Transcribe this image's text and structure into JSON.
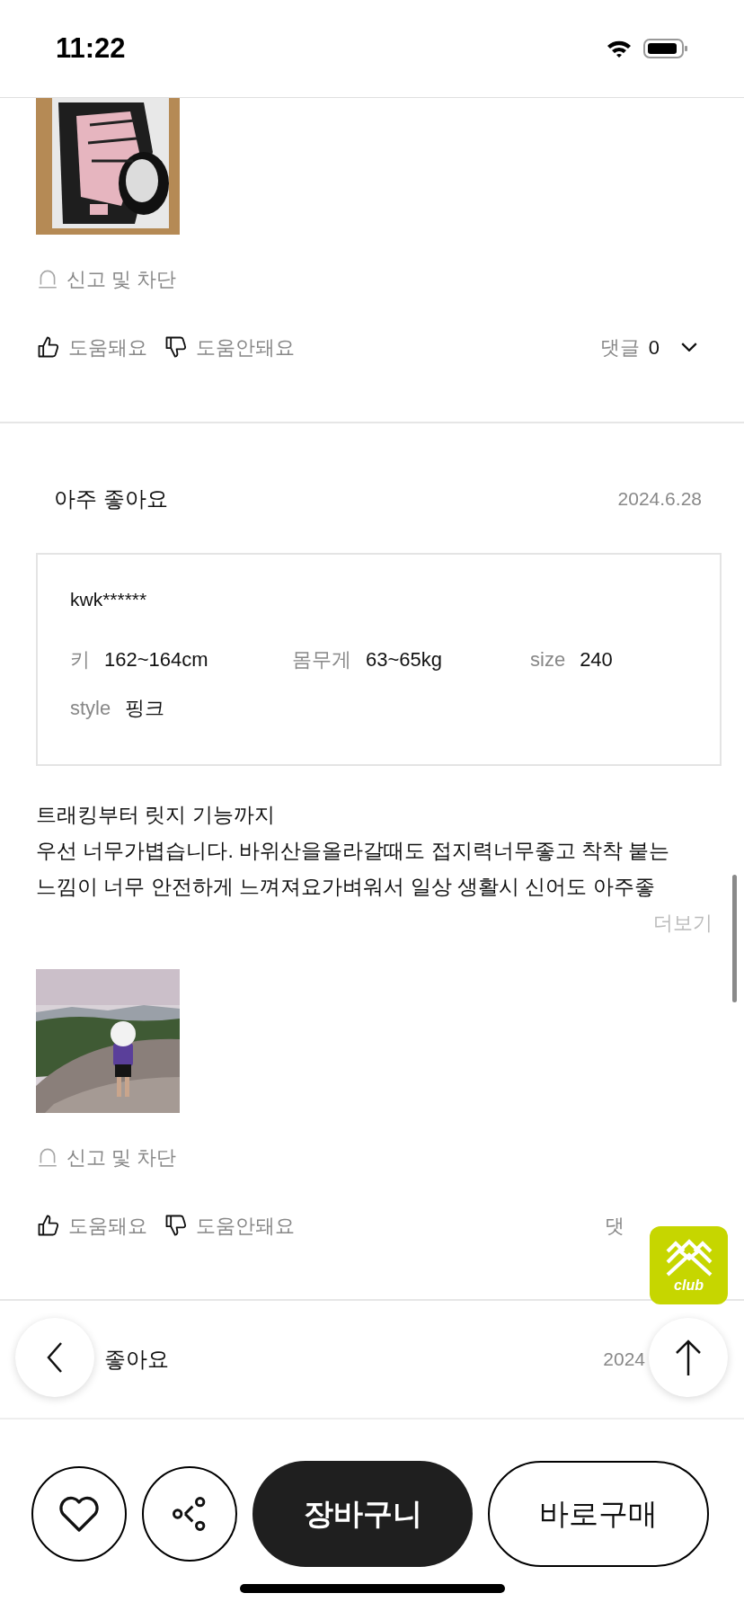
{
  "status_bar": {
    "time": "11:22"
  },
  "reviews": [
    {
      "kind": "partial",
      "report": "신고 및 차단",
      "helpful": "도움돼요",
      "not_helpful": "도움안돼요",
      "comments_label": "댓글",
      "comments_count": "0"
    },
    {
      "kind": "full",
      "title": "아주 좋아요",
      "date": "2024.6.28",
      "reviewer": "kwk******",
      "specs": [
        {
          "label": "키",
          "value": "162~164cm"
        },
        {
          "label": "몸무게",
          "value": "63~65kg"
        },
        {
          "label": "size",
          "value": "240"
        },
        {
          "label": "style",
          "value": "핑크"
        }
      ],
      "body": "트래킹부터 릿지 기능까지\n우선 너무가볍습니다. 바위산을올라갈때도 접지력너무좋고 착착 붙는\n느낌이 너무 안전하게 느껴져요가벼워서 일상 생활시 신어도 아주좋",
      "more": "더보기",
      "report": "신고 및 차단",
      "helpful": "도움돼요",
      "not_helpful": "도움안돼요",
      "comments_label": "댓"
    },
    {
      "kind": "header",
      "title": "좋아요",
      "date": "2024"
    }
  ],
  "club_badge": {
    "label": "club"
  },
  "bottom_bar": {
    "cart": "장바구니",
    "buy": "바로구매"
  }
}
